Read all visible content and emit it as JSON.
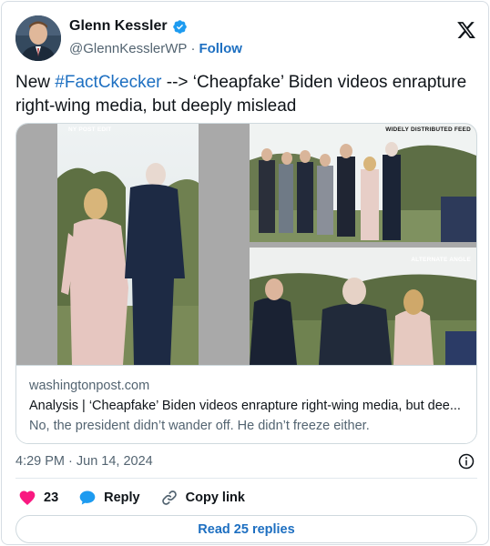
{
  "author": {
    "name": "Glenn Kessler",
    "handle": "@GlennKesslerWP",
    "separator": "·",
    "follow_label": "Follow"
  },
  "tweet": {
    "prefix": "New ",
    "hashtag": "#FactCkecker",
    "rest": " --> ‘Cheapfake’ Biden videos enrapture right-wing media, but deeply mislead"
  },
  "link_card": {
    "media": {
      "left_panel_label": "NY POST EDIT",
      "top_right_label": "WIDELY DISTRIBUTED FEED",
      "bottom_right_label": "ALTERNATE ANGLE"
    },
    "domain": "washingtonpost.com",
    "title": "Analysis | ‘Cheapfake’ Biden videos enrapture right-wing media, but dee...",
    "description": "No, the president didn’t wander off. He didn’t freeze either."
  },
  "timestamp": "4:29 PM · Jun 14, 2024",
  "actions": {
    "like_count": "23",
    "reply_label": "Reply",
    "copy_link_label": "Copy link"
  },
  "read_replies_label": "Read 25 replies",
  "colors": {
    "accent": "#1d6fc1",
    "like": "#f91880",
    "verified": "#1d9bf0",
    "secondary_text": "#536471"
  },
  "icons": [
    "verified-badge-icon",
    "x-logo-icon",
    "info-icon",
    "heart-icon",
    "reply-bubble-icon",
    "link-icon"
  ]
}
